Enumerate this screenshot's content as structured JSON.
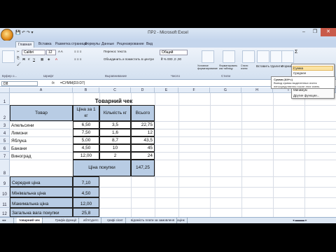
{
  "window": {
    "title": "ПР2 - Microsoft Excel"
  },
  "tabs": [
    "Главная",
    "Вставка",
    "Разметка страницы",
    "Формулы",
    "Данные",
    "Рецензирование",
    "Вид"
  ],
  "ribbon": {
    "font_name": "Calibri",
    "font_size": "12",
    "number_format": "Общий",
    "wrap_text": "Перенос текста",
    "merge_center": "Объединить и поместить в центре",
    "groups": {
      "clipboard": "Буфер о...",
      "font": "Шрифт",
      "alignment": "Выравнивание",
      "number": "Число",
      "styles": "Стили"
    },
    "styles": {
      "conditional": "Условное форматирование",
      "format_table": "Форматировать как таблицу",
      "cell_styles": "Стили ячеек"
    },
    "cells": {
      "insert": "Вставить",
      "delete": "Удалить",
      "format": "Формат"
    }
  },
  "sum_menu": {
    "items": [
      "Сумма",
      "Среднее",
      "Число",
      "Максимум",
      "Минимум",
      "Другие функции..."
    ],
    "tooltip_title": "Сумма (Alt+=)",
    "tooltip_text": "Вывод суммы выделенных ячеек непосредственно после этих ячеек."
  },
  "formula_bar": {
    "cell": "D8",
    "fx": "fx",
    "formula": "=СУММ(D3:D7)"
  },
  "columns": [
    "A",
    "B",
    "C",
    "D",
    "E",
    "F",
    "G",
    "H",
    "I",
    "J"
  ],
  "rows": [
    "1",
    "2",
    "3",
    "4",
    "5",
    "6",
    "7",
    "8",
    "9",
    "10",
    "11",
    "12"
  ],
  "sheet": {
    "title": "Товарний чек",
    "headers": {
      "product": "Товар",
      "price": "Ціна за 1 кг",
      "qty": "Кількість кг",
      "total": "Всього"
    },
    "items": [
      {
        "product": "Апельсини",
        "price": "6,50",
        "qty": "3,5",
        "total": "22,75"
      },
      {
        "product": "Лимони",
        "price": "7,50",
        "qty": "1,6",
        "total": "12"
      },
      {
        "product": "Яблука",
        "price": "5,00",
        "qty": "8,7",
        "total": "43,5"
      },
      {
        "product": "Банани",
        "price": "4,50",
        "qty": "10",
        "total": "45"
      },
      {
        "product": "Виноград",
        "price": "12,00",
        "qty": "2",
        "total": "24"
      }
    ],
    "purchase_label": "Ціна покупки",
    "purchase_total": "147,25",
    "summary": [
      {
        "label": "Середня ціна",
        "value": "7,10"
      },
      {
        "label": "Мінімальна ціна",
        "value": "4,50"
      },
      {
        "label": "Макимальна ціна",
        "value": "12,00"
      },
      {
        "label": "Загальна вага покупки",
        "value": "25,8"
      }
    ]
  },
  "sheet_tabs": [
    "товарний чек",
    "Графік функції",
    "аб'ятуретс",
    "графі сісит",
    "відомість плати за замовленя",
    "оцінк"
  ],
  "colors": {
    "accent": "#b8cce4",
    "header": "#e4ecf7"
  }
}
